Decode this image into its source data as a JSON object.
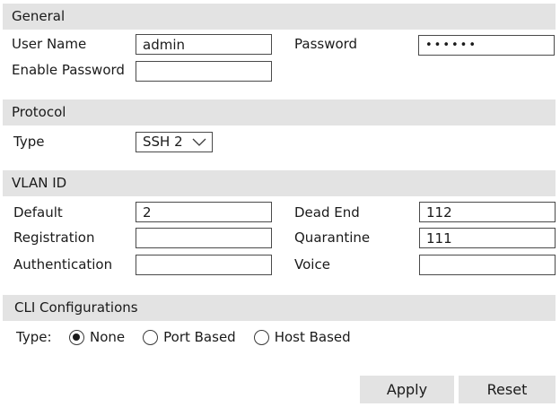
{
  "general": {
    "header": "General",
    "user_name_label": "User Name",
    "user_name_value": "admin",
    "password_label": "Password",
    "password_value": "••••••",
    "enable_password_label": "Enable Password",
    "enable_password_value": ""
  },
  "protocol": {
    "header": "Protocol",
    "type_label": "Type",
    "type_selected": "SSH 2"
  },
  "vlan": {
    "header": "VLAN ID",
    "default_label": "Default",
    "default_value": "2",
    "dead_end_label": "Dead End",
    "dead_end_value": "112",
    "registration_label": "Registration",
    "registration_value": "",
    "quarantine_label": "Quarantine",
    "quarantine_value": "111",
    "authentication_label": "Authentication",
    "authentication_value": "",
    "voice_label": "Voice",
    "voice_value": ""
  },
  "cli": {
    "header": "CLI Configurations",
    "type_label": "Type:",
    "options": [
      {
        "label": "None",
        "checked": true
      },
      {
        "label": "Port Based",
        "checked": false
      },
      {
        "label": "Host Based",
        "checked": false
      }
    ]
  },
  "actions": {
    "apply_label": "Apply",
    "reset_label": "Reset"
  },
  "icons": {
    "select_chevron": "chevron-down-icon"
  }
}
